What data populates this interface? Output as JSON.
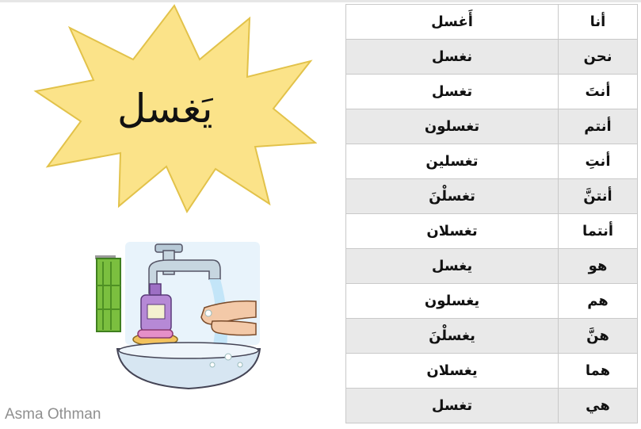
{
  "title_word": "يَغسل",
  "watermark": "Asma Othman",
  "colors": {
    "burst_fill": "#fbe389",
    "burst_stroke": "#e2c24a",
    "row_alt": "#e9e9e9",
    "grid": "#c9c9c9"
  },
  "illustration": {
    "icon": "handwashing-sink-icon"
  },
  "table": {
    "rows": [
      {
        "pronoun": "أنا",
        "verb": "أَغسل"
      },
      {
        "pronoun": "نحن",
        "verb": "نغسل"
      },
      {
        "pronoun": "أنتَ",
        "verb": "تغسل"
      },
      {
        "pronoun": "أنتم",
        "verb": "تغسلون"
      },
      {
        "pronoun": "أنتِ",
        "verb": "تغسلين"
      },
      {
        "pronoun": "أنتنَّ",
        "verb": "تغسلْنَ"
      },
      {
        "pronoun": "أنتما",
        "verb": "تغسلان"
      },
      {
        "pronoun": "هو",
        "verb": "يغسل"
      },
      {
        "pronoun": "هم",
        "verb": "يغسلون"
      },
      {
        "pronoun": "هنَّ",
        "verb": "يغسلْنَ"
      },
      {
        "pronoun": "هما",
        "verb": "يغسلان"
      },
      {
        "pronoun": "هي",
        "verb": "تغسل"
      }
    ]
  }
}
